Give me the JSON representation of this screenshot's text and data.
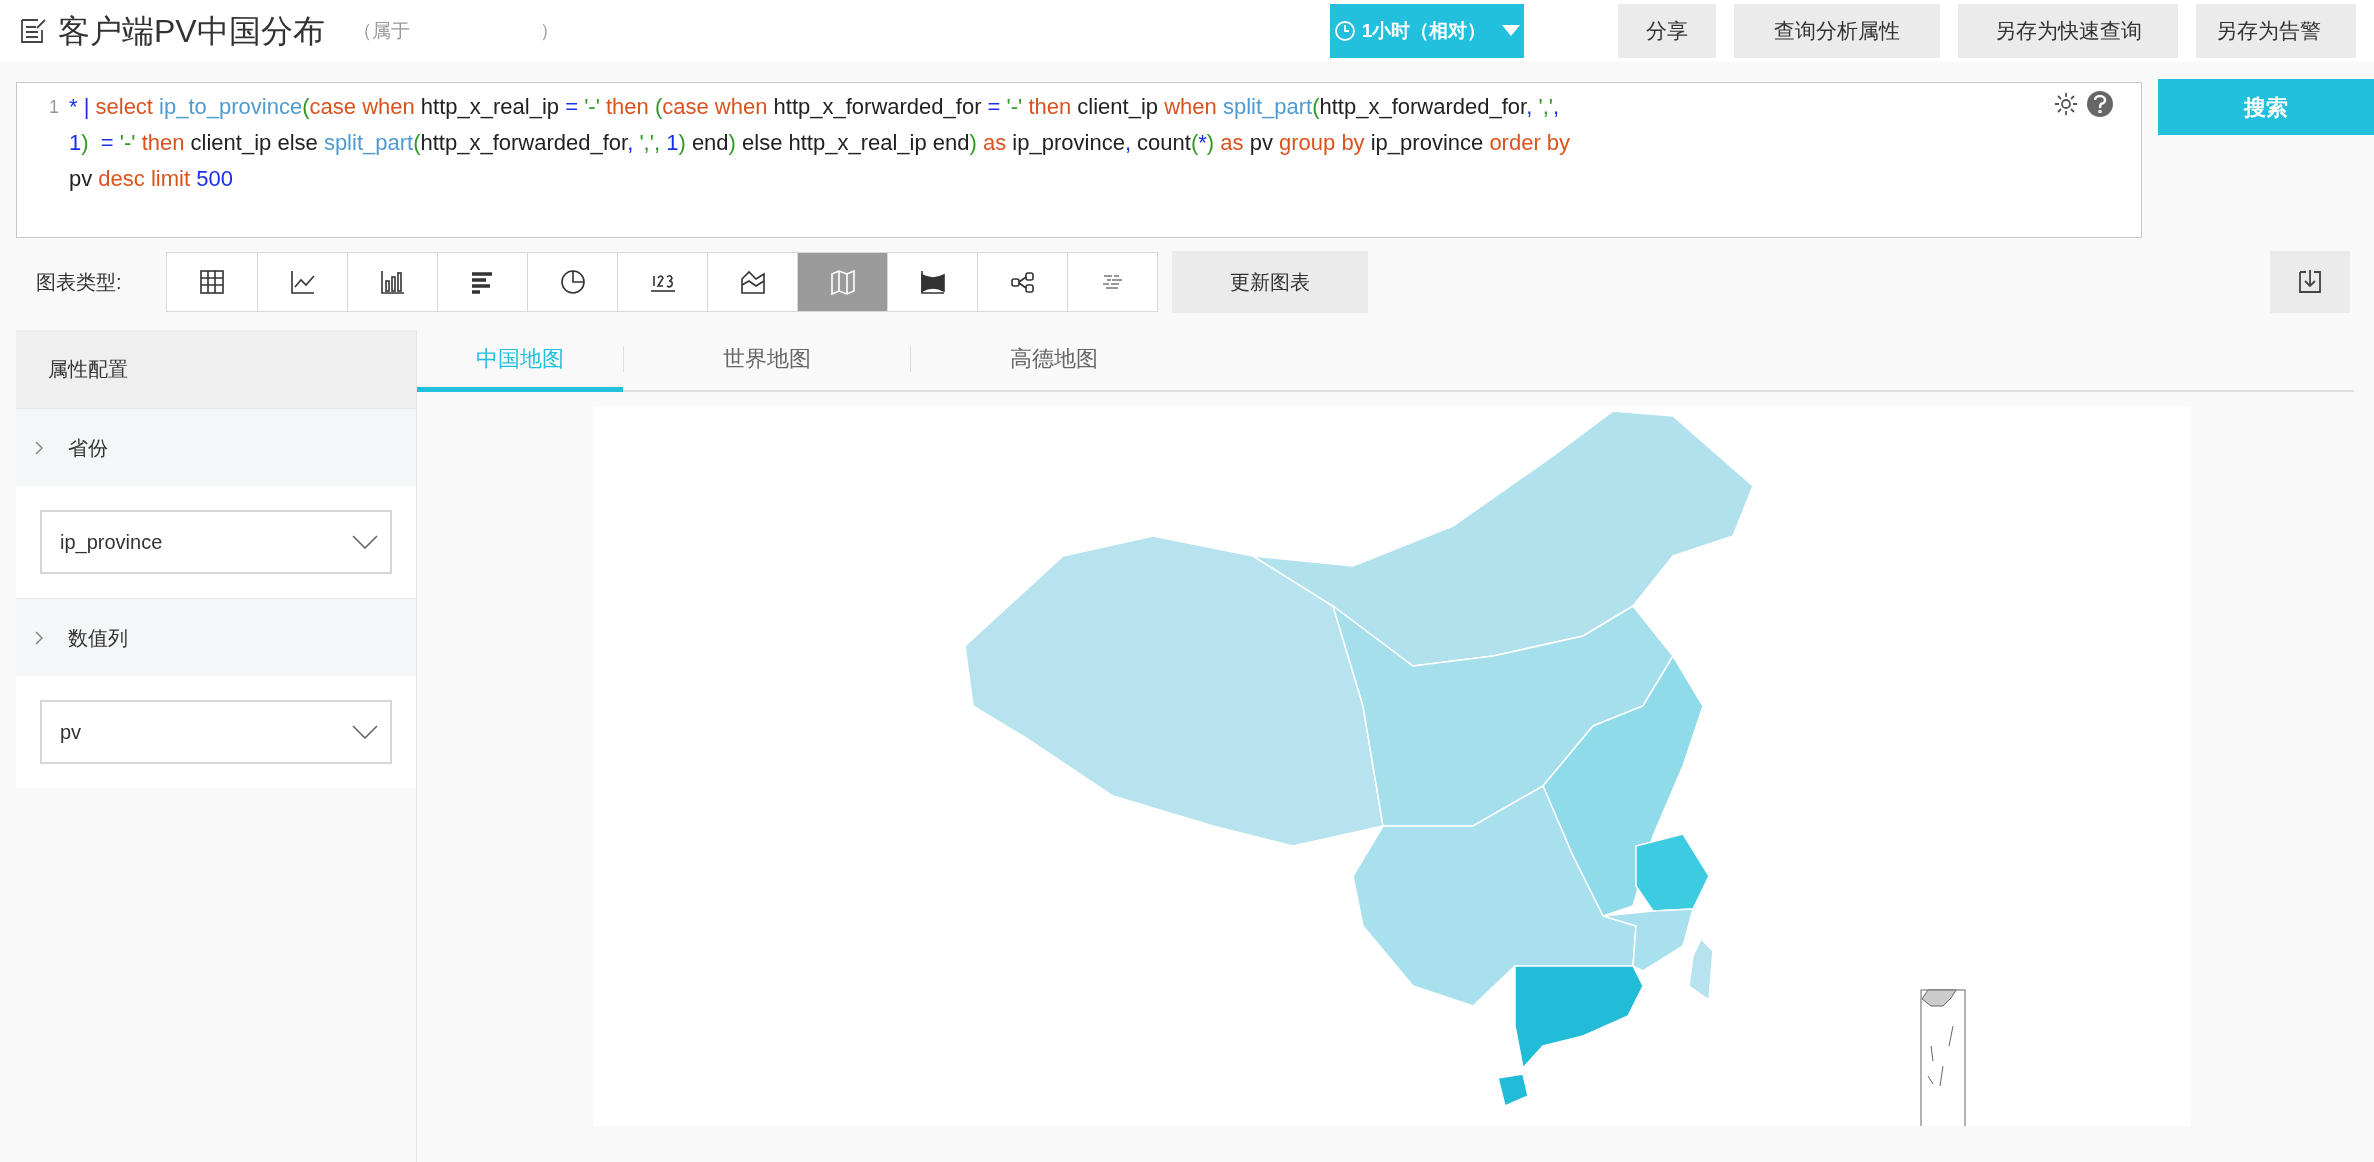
{
  "header": {
    "title": "客户端PV中国分布",
    "owner_prefix": "（属于",
    "owner_suffix": "）",
    "time_button": "1小时（相对）",
    "buttons": [
      "分享",
      "查询分析属性",
      "另存为快速查询",
      "另存为告警"
    ]
  },
  "query": {
    "line_number": "1",
    "rows": [
      {
        "segments": [
          {
            "text": "* | ",
            "color": "#1a2fe8"
          },
          {
            "text": "select ",
            "color": "#d9531e"
          },
          {
            "text": "ip_to_province",
            "color": "#4f9ad0"
          },
          {
            "text": "(",
            "color": "#2e9b26"
          },
          {
            "text": "case when ",
            "color": "#d9531e"
          },
          {
            "text": "http_x_real_ip ",
            "color": "#222222"
          },
          {
            "text": "= ",
            "color": "#1a2fe8"
          },
          {
            "text": "'-' ",
            "color": "#2e9b26"
          },
          {
            "text": "then ",
            "color": "#d9531e"
          },
          {
            "text": "(",
            "color": "#2e9b26"
          },
          {
            "text": "case when ",
            "color": "#d9531e"
          },
          {
            "text": "http_x_forwarded_for ",
            "color": "#222222"
          },
          {
            "text": "= ",
            "color": "#1a2fe8"
          },
          {
            "text": "'-' ",
            "color": "#2e9b26"
          },
          {
            "text": "then ",
            "color": "#d9531e"
          },
          {
            "text": "client_ip ",
            "color": "#222222"
          },
          {
            "text": "when ",
            "color": "#d9531e"
          },
          {
            "text": "split_part",
            "color": "#4f9ad0"
          },
          {
            "text": "(",
            "color": "#2e9b26"
          },
          {
            "text": "http_x_forwarded_for",
            "color": "#222222"
          },
          {
            "text": ", ",
            "color": "#1a2fe8"
          },
          {
            "text": "','",
            "color": "#2e9b26"
          },
          {
            "text": ",",
            "color": "#1a2fe8"
          }
        ]
      },
      {
        "segments": [
          {
            "text": "1",
            "color": "#1a2fe8"
          },
          {
            "text": ")  ",
            "color": "#2e9b26"
          },
          {
            "text": "= ",
            "color": "#1a2fe8"
          },
          {
            "text": "'-' ",
            "color": "#2e9b26"
          },
          {
            "text": "then ",
            "color": "#d9531e"
          },
          {
            "text": "client_ip else ",
            "color": "#222222"
          },
          {
            "text": "split_part",
            "color": "#4f9ad0"
          },
          {
            "text": "(",
            "color": "#2e9b26"
          },
          {
            "text": "http_x_forwarded_for",
            "color": "#222222"
          },
          {
            "text": ", ",
            "color": "#1a2fe8"
          },
          {
            "text": "',', ",
            "color": "#2e9b26"
          },
          {
            "text": "1",
            "color": "#1a2fe8"
          },
          {
            "text": ") ",
            "color": "#2e9b26"
          },
          {
            "text": "end",
            "color": "#222222"
          },
          {
            "text": ") ",
            "color": "#2e9b26"
          },
          {
            "text": "else http_x_real_ip end",
            "color": "#222222"
          },
          {
            "text": ") ",
            "color": "#2e9b26"
          },
          {
            "text": "as ",
            "color": "#d9531e"
          },
          {
            "text": "ip_province",
            "color": "#222222"
          },
          {
            "text": ", ",
            "color": "#1a2fe8"
          },
          {
            "text": "count",
            "color": "#222222"
          },
          {
            "text": "(",
            "color": "#2e9b26"
          },
          {
            "text": "*",
            "color": "#1a2fe8"
          },
          {
            "text": ") ",
            "color": "#2e9b26"
          },
          {
            "text": "as ",
            "color": "#d9531e"
          },
          {
            "text": "pv ",
            "color": "#222222"
          },
          {
            "text": "group by ",
            "color": "#d9531e"
          },
          {
            "text": "ip_province ",
            "color": "#222222"
          },
          {
            "text": "order by",
            "color": "#d9531e"
          }
        ]
      },
      {
        "segments": [
          {
            "text": "pv ",
            "color": "#222222"
          },
          {
            "text": "desc limit ",
            "color": "#d9531e"
          },
          {
            "text": "500",
            "color": "#1a2fe8"
          }
        ]
      }
    ],
    "search_button": "搜索"
  },
  "chart_types": {
    "label": "图表类型:",
    "items": [
      {
        "kind": "table",
        "selected": false
      },
      {
        "kind": "line",
        "selected": false
      },
      {
        "kind": "column",
        "selected": false
      },
      {
        "kind": "bar",
        "selected": false
      },
      {
        "kind": "pie",
        "selected": false
      },
      {
        "kind": "number",
        "selected": false
      },
      {
        "kind": "area",
        "selected": false
      },
      {
        "kind": "map",
        "selected": true
      },
      {
        "kind": "flow",
        "selected": false
      },
      {
        "kind": "sankey",
        "selected": false
      },
      {
        "kind": "wordcloud",
        "selected": false
      }
    ],
    "update_button": "更新图表"
  },
  "config": {
    "title": "属性配置",
    "sections": [
      {
        "label": "省份",
        "value": "ip_province"
      },
      {
        "label": "数值列",
        "value": "pv"
      }
    ]
  },
  "map_tabs": [
    {
      "label": "中国地图",
      "selected": true
    },
    {
      "label": "世界地图",
      "selected": false
    },
    {
      "label": "高德地图",
      "selected": false
    }
  ]
}
